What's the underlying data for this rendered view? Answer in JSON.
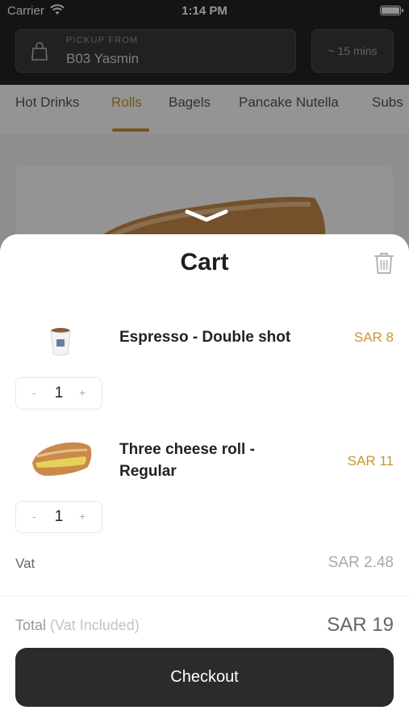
{
  "status": {
    "carrier": "Carrier",
    "time": "1:14 PM"
  },
  "header": {
    "pickup_label": "PICKUP FROM",
    "pickup_value": "B03 Yasmin",
    "eta": "~ 15 mins"
  },
  "tabs": [
    "Hot Drinks",
    "Rolls",
    "Bagels",
    "Pancake Nutella",
    "Subs"
  ],
  "active_tab": "Rolls",
  "cart": {
    "title": "Cart",
    "items": [
      {
        "name": "Espresso - Double shot",
        "price": "SAR 8",
        "qty": "1"
      },
      {
        "name_line1": "Three cheese roll -",
        "name_line2": "Regular",
        "price": "SAR 11",
        "qty": "1"
      }
    ],
    "vat_label": "Vat",
    "vat_value": "SAR 2.48",
    "total_label": "Total",
    "total_sub": "(Vat Included)",
    "total_value": "SAR 19",
    "checkout_label": "Checkout",
    "minus": "-",
    "plus": "+"
  },
  "colors": {
    "accent": "#c8962c",
    "dark": "#2b2b2b"
  }
}
